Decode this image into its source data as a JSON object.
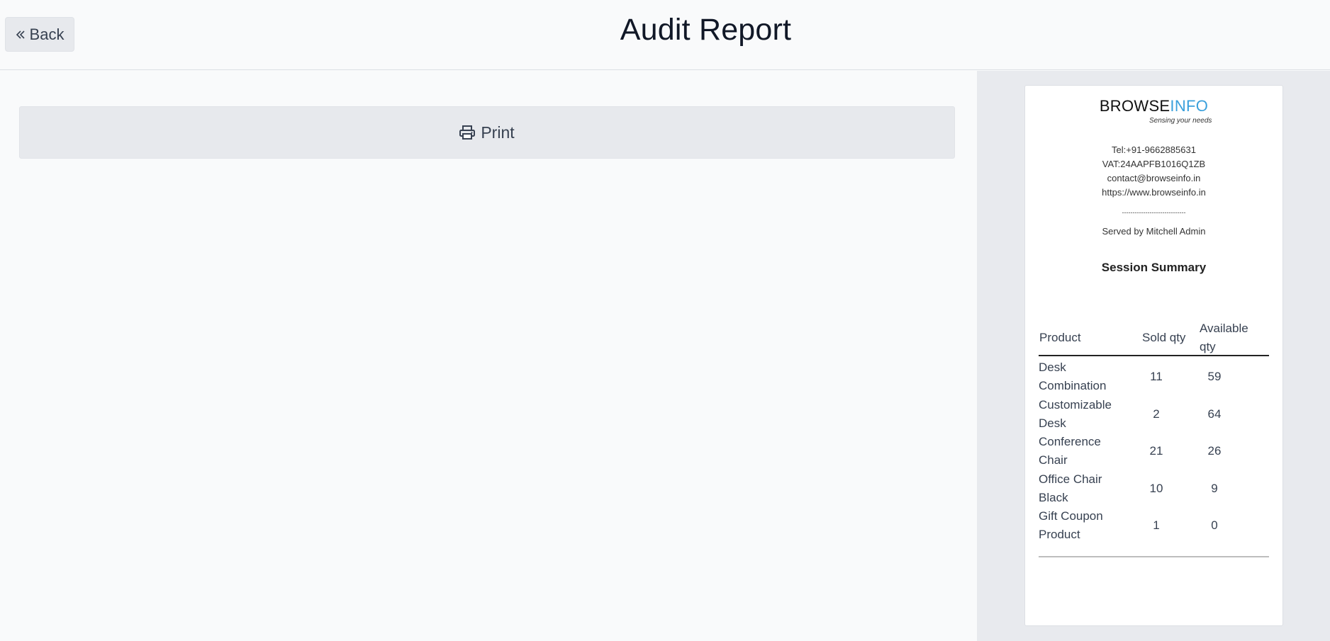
{
  "header": {
    "back_label": "Back",
    "title": "Audit Report"
  },
  "actions": {
    "print_label": "Print"
  },
  "receipt": {
    "logo": {
      "brand_first": "BROWSE",
      "brand_second": "INFO",
      "tagline": "Sensing your needs",
      "brand_colors": {
        "first": "#111111",
        "second": "#3aa0dc"
      }
    },
    "contact": {
      "tel": "Tel:+91-9662885631",
      "vat": "VAT:24AAPFB1016Q1ZB",
      "email": "contact@browseinfo.in",
      "website": "https://www.browseinfo.in"
    },
    "separator": "------------------------------",
    "served_by": "Served by Mitchell Admin",
    "summary_title": "Session Summary",
    "table": {
      "headers": {
        "product": "Product",
        "sold": "Sold qty",
        "available": "Available qty"
      },
      "rows": [
        {
          "product": "Desk Combination",
          "sold": "11",
          "available": "59"
        },
        {
          "product": "Customizable Desk",
          "sold": "2",
          "available": "64"
        },
        {
          "product": "Conference Chair",
          "sold": "21",
          "available": "26"
        },
        {
          "product": "Office Chair Black",
          "sold": "10",
          "available": "9"
        },
        {
          "product": "Gift Coupon Product",
          "sold": "1",
          "available": "0"
        }
      ]
    }
  }
}
